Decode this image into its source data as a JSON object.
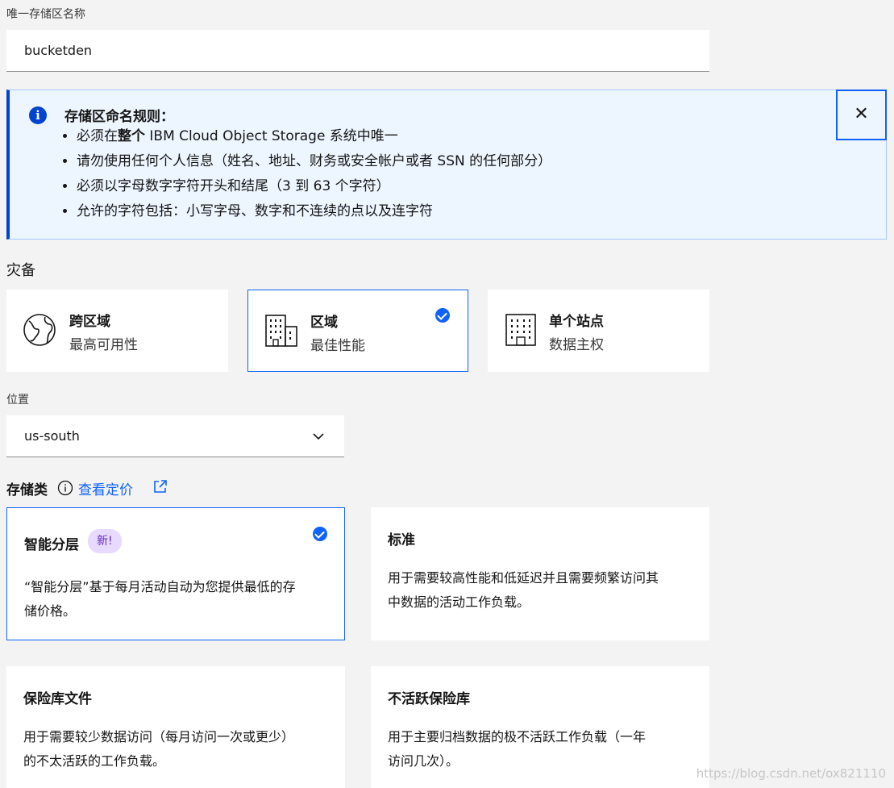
{
  "bucket": {
    "label": "唯一存储区名称",
    "value": "bucketden"
  },
  "notice": {
    "title": "存储区命名规则：",
    "rules": [
      "必须在整个 IBM Cloud Object Storage 系统中唯一",
      "请勿使用任何个人信息（姓名、地址、财务或安全帐户或者 SSN 的任何部分）",
      "必须以字母数字字符开头和结尾（3 到 63 个字符）",
      "允许的字符包括：小写字母、数字和不连续的点以及连字符"
    ],
    "close_icon": "close-icon"
  },
  "resiliency": {
    "label": "灾备",
    "options": [
      {
        "title": "跨区域",
        "subtitle": "最高可用性",
        "icon": "globe-icon",
        "selected": false
      },
      {
        "title": "区域",
        "subtitle": "最佳性能",
        "icon": "building-icon",
        "selected": true
      },
      {
        "title": "单个站点",
        "subtitle": "数据主权",
        "icon": "building-icon",
        "selected": false
      }
    ]
  },
  "location": {
    "label": "位置",
    "value": "us-south"
  },
  "storage_class": {
    "label": "存储类",
    "pricing_link": "查看定价",
    "options": [
      {
        "title": "智能分层",
        "badge": "新!",
        "desc": "“智能分层”基于每月活动自动为您提供最低的存储价格。",
        "selected": true
      },
      {
        "title": "标准",
        "desc": "用于需要较高性能和低延迟并且需要频繁访问其中数据的活动工作负载。",
        "selected": false
      },
      {
        "title": "保险库文件",
        "desc": "用于需要较少数据访问（每月访问一次或更少）的不太活跃的工作负载。",
        "selected": false
      },
      {
        "title": "不活跃保险库",
        "desc": "用于主要归档数据的极不活跃工作负载（一年访问几次）。",
        "selected": false
      }
    ]
  },
  "watermark": "https://blog.csdn.net/ox821110",
  "colors": {
    "accent": "#0f62fe",
    "notice_bg": "#edf5ff",
    "badge_bg": "#e8daff"
  }
}
